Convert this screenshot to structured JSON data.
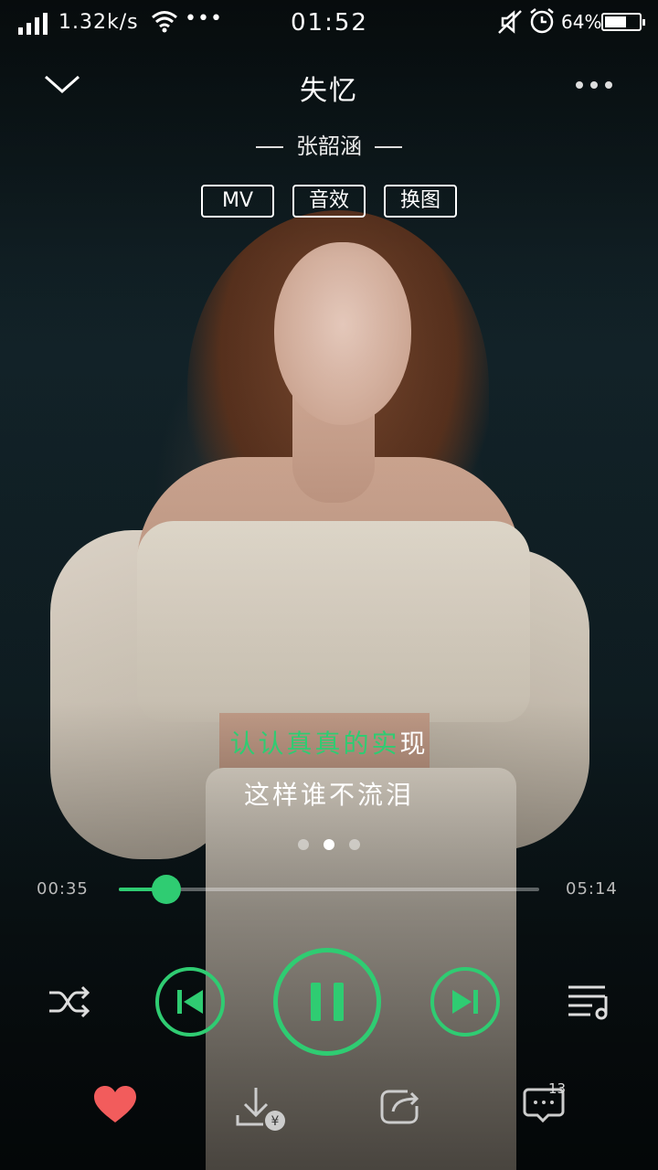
{
  "status_bar": {
    "net_speed": "1.32k/s",
    "more": "•••",
    "time": "01:52",
    "battery_pct": "64%",
    "battery_level": 0.64
  },
  "header": {
    "song_title": "失忆",
    "artist": "张韶涵",
    "more_icon": "more-dots-icon",
    "collapse_icon": "chevron-down-icon"
  },
  "tags": [
    {
      "label": "MV"
    },
    {
      "label": "音效"
    },
    {
      "label": "换图"
    }
  ],
  "lyrics": {
    "current_sung": "认认真真的实",
    "current_rest": "现",
    "next": "这样谁不流泪"
  },
  "pager": {
    "count": 3,
    "active": 1
  },
  "progress": {
    "current": "00:35",
    "total": "05:14",
    "fraction": 0.112
  },
  "comments": {
    "count": "13"
  },
  "colors": {
    "accent": "#2fcc72",
    "heart": "#f25c5c"
  },
  "icons": [
    "shuffle-icon",
    "previous-icon",
    "pause-icon",
    "next-icon",
    "playlist-icon",
    "heart-icon",
    "download-paid-icon",
    "share-icon",
    "comment-icon"
  ]
}
